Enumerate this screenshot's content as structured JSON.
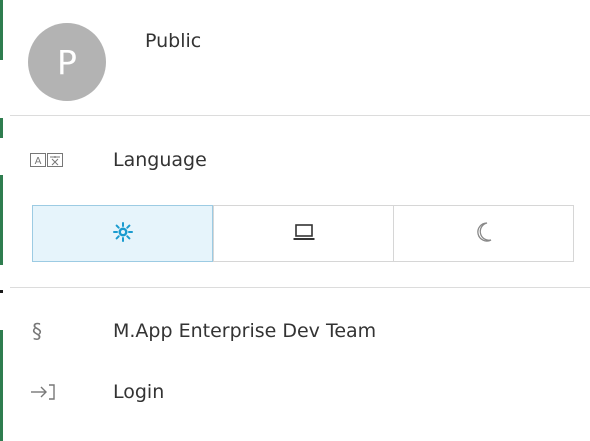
{
  "user": {
    "avatar_letter": "P",
    "name": "Public"
  },
  "menu": {
    "language_label": "Language",
    "team_label": "M.App Enterprise Dev Team",
    "login_label": "Login"
  },
  "theme": {
    "options": [
      {
        "icon": "sun-icon",
        "active": true
      },
      {
        "icon": "laptop-icon",
        "active": false
      },
      {
        "icon": "moon-icon",
        "active": false
      }
    ]
  },
  "colors": {
    "accent": "#1a9bcf",
    "active_bg": "#e6f4fb",
    "avatar_bg": "#b3b3b3"
  }
}
